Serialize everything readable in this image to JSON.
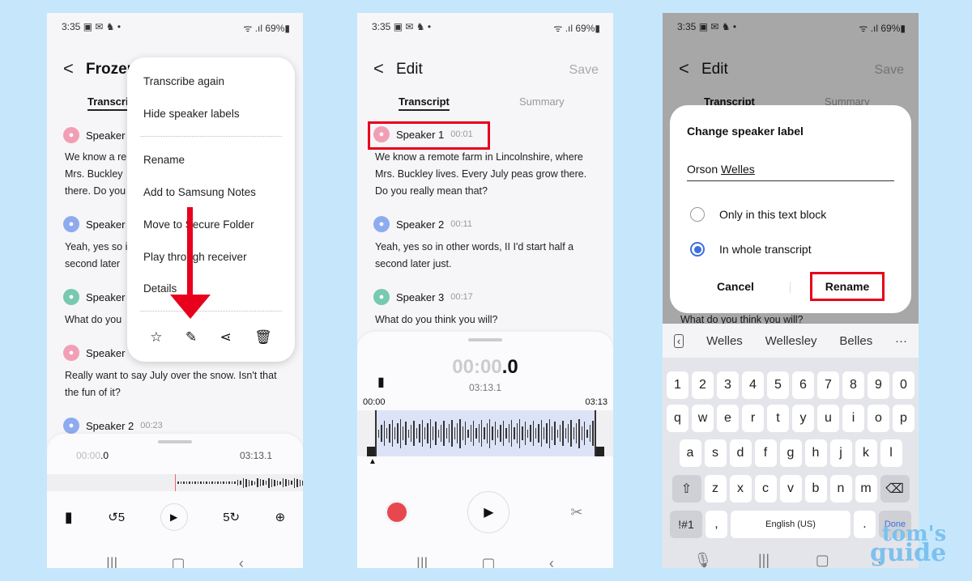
{
  "status": {
    "time": "3:35",
    "notif_icons": "▣ ✉ ♞ •",
    "right": "ᯤ .ıl 69%▮"
  },
  "transcript": {
    "segments": [
      {
        "speaker": "Speaker 1",
        "time": "00:01",
        "color": "#f29fb5",
        "text": "We know a remote farm in Lincolnshire, where Mrs. Buckley lives. Every July peas grow there. Do you really mean that?"
      },
      {
        "speaker": "Speaker 2",
        "time": "00:11",
        "color": "#8eaaf0",
        "text": "Yeah, yes so in other words, II I'd start half a second later just."
      },
      {
        "speaker": "Speaker 3",
        "time": "00:17",
        "color": "#77c9b0",
        "text": "What do you think you will?"
      },
      {
        "speaker": "Speaker",
        "time": "",
        "color": "#f29fb5",
        "text": "Really want to say July over the snow. Isn't that the fun of it?"
      },
      {
        "speaker": "Speaker 2",
        "time": "00:23",
        "color": "#8eaaf0",
        "text": ""
      }
    ]
  },
  "screen1": {
    "title": "Frozer",
    "tab": "Transcri",
    "speaker_cut": "Speaker",
    "text_cut": [
      "We know a re",
      "Mrs. Buckley",
      "there. Do you",
      "Yeah, yes so i",
      "second later",
      "What do you"
    ],
    "menu": [
      "Transcribe again",
      "Hide speaker labels",
      "Rename",
      "Add to Samsung Notes",
      "Move to Secure Folder",
      "Play through receiver",
      "Details"
    ],
    "menu_icons": [
      "star-icon",
      "pencil-icon",
      "share-icon",
      "trash-icon"
    ],
    "player": {
      "elapsed_dim": "00:00",
      "elapsed": ".0",
      "total": "03:13.1"
    }
  },
  "screen2": {
    "back": "<",
    "title": "Edit",
    "save": "Save",
    "tabs": [
      "Transcript",
      "Summary"
    ],
    "player": {
      "elapsed_dim": "00:00",
      "elapsed": ".0",
      "total": "03:13.1",
      "start": "00:00",
      "end": "03:13"
    }
  },
  "screen3": {
    "title": "Edit",
    "save": "Save",
    "tabs": [
      "Transcript",
      "Summary"
    ],
    "behind_text": "What do you think you will?",
    "dialog": {
      "title": "Change speaker label",
      "value_first": "Orson ",
      "value_second": "Welles",
      "options": [
        "Only in this text block",
        "In whole transcript"
      ],
      "selected": 1,
      "cancel": "Cancel",
      "rename": "Rename"
    },
    "suggestions": [
      "Welles",
      "Wellesley",
      "Belles"
    ],
    "keys": {
      "row1": [
        "1",
        "2",
        "3",
        "4",
        "5",
        "6",
        "7",
        "8",
        "9",
        "0"
      ],
      "row2": [
        "q",
        "w",
        "e",
        "r",
        "t",
        "y",
        "u",
        "i",
        "o",
        "p"
      ],
      "row3": [
        "a",
        "s",
        "d",
        "f",
        "g",
        "h",
        "j",
        "k",
        "l"
      ],
      "row4": [
        "z",
        "x",
        "c",
        "v",
        "b",
        "n",
        "m"
      ],
      "sym": "!#1",
      "comma": ",",
      "space": "English (US)",
      "period": ".",
      "done": "Done"
    }
  },
  "watermark": {
    "line1": "tom's",
    "line2": "guide"
  },
  "colors": {
    "accent_red": "#e8001c",
    "radio_blue": "#3b6fe0",
    "background": "#c6e7fb"
  }
}
